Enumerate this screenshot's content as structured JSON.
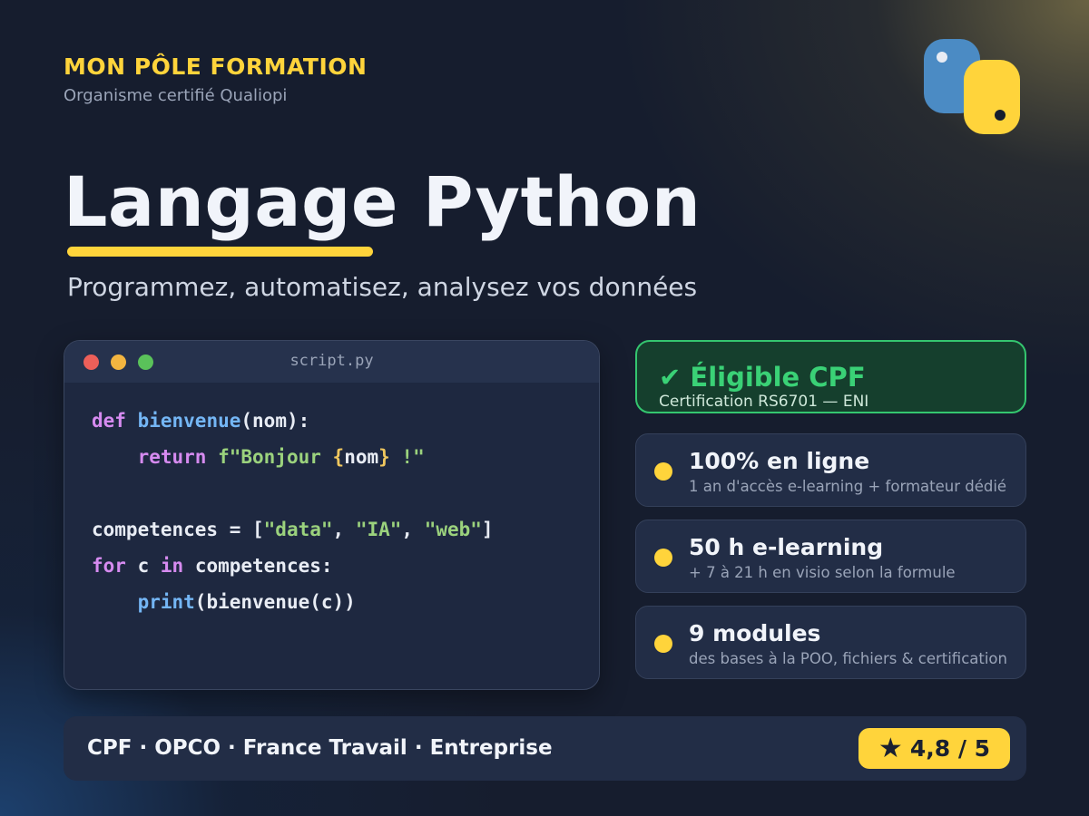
{
  "brand": {
    "name": "MON PÔLE FORMATION",
    "subtitle": "Organisme certifié Qualiopi"
  },
  "logo": {
    "icon": "python-logo-icon",
    "colors": {
      "blue": "#4b8bc4",
      "yellow": "#ffd43b"
    }
  },
  "hero": {
    "title": "Langage Python",
    "subtitle": "Programmez, automatisez, analysez vos données"
  },
  "code_window": {
    "filename": "script.py",
    "lines": [
      "def bienvenue(nom):",
      "    return f\"Bonjour {nom} !\"",
      "",
      "competences = [\"data\", \"IA\", \"web\"]",
      "for c in competences:",
      "    print(bienvenue(c))"
    ],
    "tokens": {
      "def": "def",
      "bienvenue": "bienvenue",
      "params": "(nom):",
      "return": "return",
      "fstring_start": "f\"Bonjour ",
      "brace_open": "{",
      "nom": "nom",
      "brace_close": "}",
      "fstring_end": " !\"",
      "competences_assign": "competences = [",
      "s_data": "\"data\"",
      "comma1": ", ",
      "s_ia": "\"IA\"",
      "comma2": ", ",
      "s_web": "\"web\"",
      "bracket_close": "]",
      "for": "for",
      "c_var": " c ",
      "in": "in",
      "loop_rest": " competences:",
      "print": "print",
      "print_args": "(bienvenue(c))"
    }
  },
  "cpf": {
    "check_icon": "✔",
    "title": "Éligible CPF",
    "subtitle": "Certification RS6701 — ENI"
  },
  "features": [
    {
      "title": "100% en ligne",
      "subtitle": "1 an d'accès e-learning + formateur dédié"
    },
    {
      "title": "50 h e-learning",
      "subtitle": "+ 7 à 21 h en visio selon la formule"
    },
    {
      "title": "9 modules",
      "subtitle": "des bases à la POO, fichiers & certification"
    }
  ],
  "footer": {
    "funding": "CPF · OPCO · France Travail · Entreprise",
    "star_icon": "★",
    "rating": "4,8 / 5"
  },
  "colors": {
    "accent": "#ffd43b",
    "success": "#3ad176",
    "background": "#161d2e"
  }
}
